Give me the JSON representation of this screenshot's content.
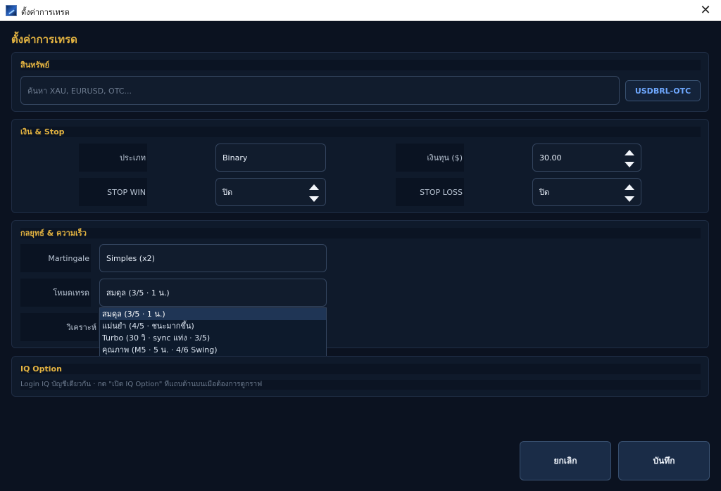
{
  "window": {
    "title": "ตั้งค่าการเทรด",
    "close_glyph": "✕"
  },
  "page": {
    "heading": "ตั้งค่าการเทรด"
  },
  "asset": {
    "section_title": "สินทรัพย์",
    "search_placeholder": "ค้นหา XAU, EURUSD, OTC...",
    "selected_asset": "USDBRL-OTC"
  },
  "money": {
    "section_title": "เงิน & Stop",
    "type_label": "ประเภท",
    "type_value": "Binary",
    "capital_label": "เงินทุน ($)",
    "capital_value": "30.00",
    "stop_win_label": "STOP WIN",
    "stop_win_value": "ปิด",
    "stop_loss_label": "STOP LOSS",
    "stop_loss_value": "ปิด"
  },
  "strategy": {
    "section_title": "กลยุทธ์ & ความเร็ว",
    "martingale_label": "Martingale",
    "martingale_value": "Simples (x2)",
    "mode_label": "โหมดเทรด",
    "mode_value": "สมดุล (3/5 · 1 น.)",
    "analysis_label": "วิเคราะห์",
    "mode_options": [
      "สมดุล (3/5 · 1 น.)",
      "แม่นยำ (4/5 · ชนะมากขึ้น)",
      "Turbo (30 วิ · sync แท่ง · 3/5)",
      "คุณภาพ (M5 · 5 น. · 4/6 Swing)"
    ]
  },
  "iq": {
    "section_title": "IQ Option",
    "hint": "Login IQ บัญชีเดียวกัน · กด \"เปิด IQ Option\" ที่แถบด้านบนเมื่อต้องการดูกราฟ"
  },
  "actions": {
    "cancel": "ยกเลิก",
    "save": "บันทึก"
  },
  "colors": {
    "accent": "#e3b341",
    "background": "#0b1220",
    "link": "#6fa8ff"
  }
}
